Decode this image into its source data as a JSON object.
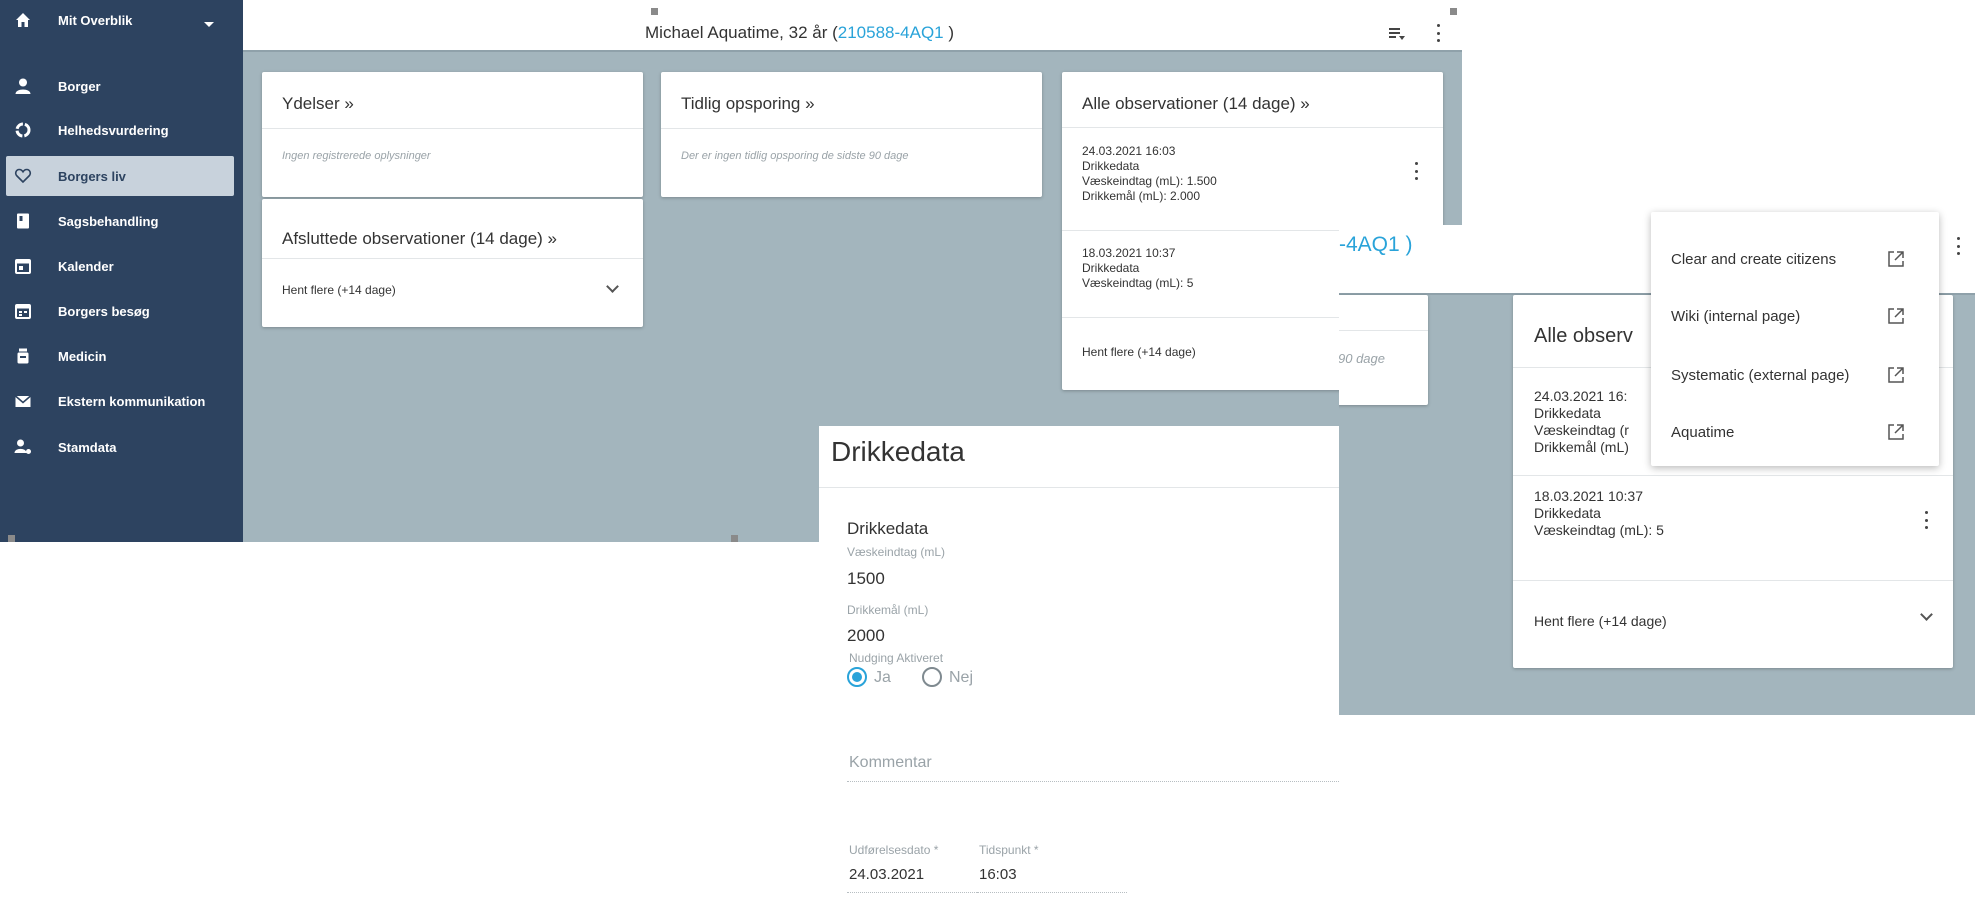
{
  "colors": {
    "sidebar_bg": "#2d4360",
    "sidebar_active_bg": "#c8d2dc",
    "content_bg": "#a3b5bd",
    "accent": "#29a3d9",
    "card_bg": "#ffffff"
  },
  "header": {
    "patient_name": "Michael Aquatime, 32 år (",
    "cpr": "210588-4AQ1",
    "close_paren": " )",
    "cpr_partial": "-4AQ1 )",
    "icons": [
      "list-filter-icon",
      "kebab-menu-icon"
    ]
  },
  "sidebar": {
    "items": [
      {
        "label": "Mit Overblik",
        "icon": "home-icon"
      },
      {
        "label": "Borger",
        "icon": "person-icon"
      },
      {
        "label": "Helhedsvurdering",
        "icon": "cycle-icon"
      },
      {
        "label": "Borgers liv",
        "icon": "heart-icon"
      },
      {
        "label": "Sagsbehandling",
        "icon": "book-icon"
      },
      {
        "label": "Kalender",
        "icon": "calendar-icon"
      },
      {
        "label": "Borgers besøg",
        "icon": "visit-calendar-icon"
      },
      {
        "label": "Medicin",
        "icon": "medicine-icon"
      },
      {
        "label": "Ekstern kommunikation",
        "icon": "envelope-icon"
      },
      {
        "label": "Stamdata",
        "icon": "user-data-icon"
      }
    ]
  },
  "cards": {
    "ydelser": {
      "title": "Ydelser »",
      "empty": "Ingen registrerede oplysninger"
    },
    "tidlig": {
      "title": "Tidlig opsporing »",
      "empty": "Der er ingen tidlig opsporing de sidste 90 dage",
      "empty_partial": "90 dage"
    },
    "afsluttede": {
      "title": "Afsluttede observationer (14 dage) »",
      "more": "Hent flere (+14 dage)"
    },
    "alle": {
      "title": "Alle observationer (14 dage) »",
      "title_partial": "Alle observ",
      "entries": [
        {
          "datetime": "24.03.2021 16:03",
          "type": "Drikkedata",
          "line1": "Væskeindtag (mL): 1.500",
          "line2": "Drikkemål (mL): 2.000"
        },
        {
          "datetime": "18.03.2021 10:37",
          "type": "Drikkedata",
          "line1": "Væskeindtag (mL): 5"
        }
      ],
      "entry1_partial": {
        "datetime": "24.03.2021 16:",
        "type": "Drikkedata",
        "line1": "Væskeindtag (r",
        "line2": "Drikkemål (mL)"
      },
      "more": "Hent flere (+14 dage)"
    }
  },
  "form": {
    "title": "Drikkedata",
    "section": "Drikkedata",
    "intake_label": "Væskeindtag (mL)",
    "intake_value": "1500",
    "goal_label": "Drikkemål (mL)",
    "goal_value": "2000",
    "nudging_label": "Nudging Aktiveret",
    "yes": "Ja",
    "no": "Nej",
    "nudging_selected": "Ja",
    "comment_placeholder": "Kommentar",
    "date_label": "Udførelsesdato *",
    "date_value": "24.03.2021",
    "time_label": "Tidspunkt *",
    "time_value": "16:03"
  },
  "menu": {
    "items": [
      {
        "label": "Clear and create citizens",
        "icon": "external-link-icon"
      },
      {
        "label": "Wiki (internal page)",
        "icon": "external-link-icon"
      },
      {
        "label": "Systematic (external page)",
        "icon": "external-link-icon"
      },
      {
        "label": "Aquatime",
        "icon": "external-link-icon"
      }
    ]
  }
}
